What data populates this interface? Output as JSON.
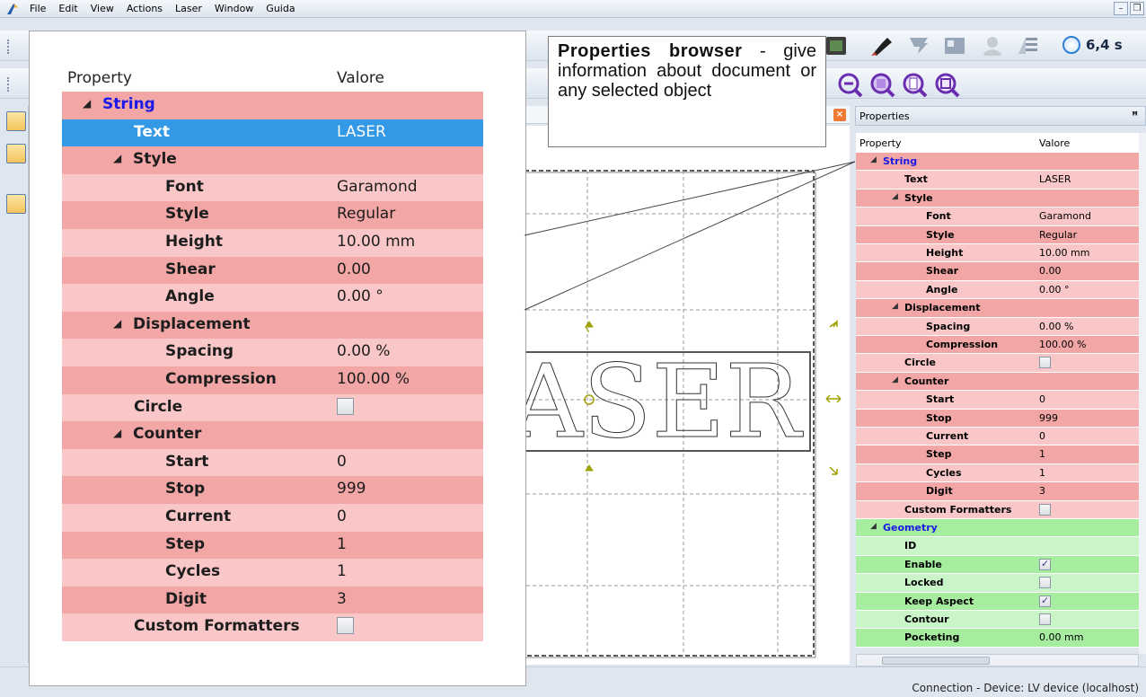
{
  "menu": [
    "File",
    "Edit",
    "View",
    "Actions",
    "Laser",
    "Window",
    "Guida"
  ],
  "toolbar": {
    "time_value": "6,4 s"
  },
  "panel_title": "Properties",
  "columns": {
    "property": "Property",
    "value": "Valore"
  },
  "callout": {
    "title": "Properties browser",
    "text": " - give information about document or any selected object"
  },
  "canvas": {
    "text": "ASER"
  },
  "status": {
    "connection": "Connection - Device: LV device (localhost)"
  },
  "properties": [
    {
      "label": "String",
      "value": "",
      "level": 0,
      "kind": "group",
      "theme": "pink",
      "title": true
    },
    {
      "label": "Text",
      "value": "LASER",
      "level": 2,
      "kind": "field",
      "theme": "pink",
      "selected": true
    },
    {
      "label": "Style",
      "value": "",
      "level": 1,
      "kind": "group",
      "theme": "pink"
    },
    {
      "label": "Font",
      "value": "Garamond",
      "level": 3,
      "kind": "field",
      "theme": "pink"
    },
    {
      "label": "Style",
      "value": "Regular",
      "level": 3,
      "kind": "field",
      "theme": "pink"
    },
    {
      "label": "Height",
      "value": "10.00 mm",
      "level": 3,
      "kind": "field",
      "theme": "pink"
    },
    {
      "label": "Shear",
      "value": "0.00",
      "level": 3,
      "kind": "field",
      "theme": "pink"
    },
    {
      "label": "Angle",
      "value": "0.00 °",
      "level": 3,
      "kind": "field",
      "theme": "pink"
    },
    {
      "label": "Displacement",
      "value": "",
      "level": 1,
      "kind": "group",
      "theme": "pink"
    },
    {
      "label": "Spacing",
      "value": "0.00 %",
      "level": 3,
      "kind": "field",
      "theme": "pink"
    },
    {
      "label": "Compression",
      "value": "100.00 %",
      "level": 3,
      "kind": "field",
      "theme": "pink"
    },
    {
      "label": "Circle",
      "value": "",
      "level": 2,
      "kind": "check",
      "checked": false,
      "theme": "pink"
    },
    {
      "label": "Counter",
      "value": "",
      "level": 1,
      "kind": "group",
      "theme": "pink"
    },
    {
      "label": "Start",
      "value": "0",
      "level": 3,
      "kind": "field",
      "theme": "pink"
    },
    {
      "label": "Stop",
      "value": "999",
      "level": 3,
      "kind": "field",
      "theme": "pink"
    },
    {
      "label": "Current",
      "value": "0",
      "level": 3,
      "kind": "field",
      "theme": "pink"
    },
    {
      "label": "Step",
      "value": "1",
      "level": 3,
      "kind": "field",
      "theme": "pink"
    },
    {
      "label": "Cycles",
      "value": "1",
      "level": 3,
      "kind": "field",
      "theme": "pink"
    },
    {
      "label": "Digit",
      "value": "3",
      "level": 3,
      "kind": "field",
      "theme": "pink"
    },
    {
      "label": "Custom Formatters",
      "value": "",
      "level": 2,
      "kind": "check",
      "checked": false,
      "theme": "pink"
    },
    {
      "label": "Geometry",
      "value": "",
      "level": 0,
      "kind": "group",
      "theme": "green",
      "title": true
    },
    {
      "label": "ID",
      "value": "",
      "level": 2,
      "kind": "field",
      "theme": "green"
    },
    {
      "label": "Enable",
      "value": "",
      "level": 2,
      "kind": "check",
      "checked": true,
      "theme": "green"
    },
    {
      "label": "Locked",
      "value": "",
      "level": 2,
      "kind": "check",
      "checked": false,
      "theme": "green"
    },
    {
      "label": "Keep Aspect",
      "value": "",
      "level": 2,
      "kind": "check",
      "checked": true,
      "theme": "green"
    },
    {
      "label": "Contour",
      "value": "",
      "level": 2,
      "kind": "check",
      "checked": false,
      "theme": "green"
    },
    {
      "label": "Pocketing",
      "value": "0.00 mm",
      "level": 2,
      "kind": "field",
      "theme": "green"
    }
  ],
  "zoom_count": 20,
  "colors": {
    "pink_light": "#f9c7c7",
    "pink_dark": "#f2a6a6",
    "green_light": "#c9f5c9",
    "green_dark": "#a7ed9f",
    "group_title": "#1a1ae6",
    "selection": "#3399e6"
  }
}
